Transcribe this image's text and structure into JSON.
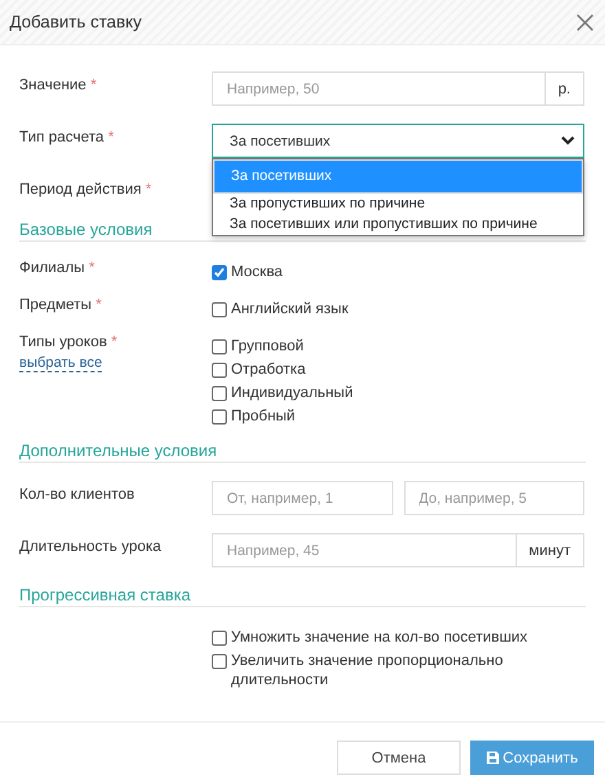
{
  "dialog": {
    "title": "Добавить ставку"
  },
  "fields": [
    {
      "kind": "input",
      "label": "Значение",
      "required_mark": "*",
      "placeholder": "Например, 50",
      "addon": "р."
    },
    {
      "kind": "select",
      "label": "Тип расчета",
      "required_mark": "*",
      "value": "За посетивших",
      "expanded": true,
      "options": [
        {
          "label": "За посетивших",
          "selected": true
        },
        {
          "label": "За пропустивших по причине",
          "selected": false
        },
        {
          "label": "За посетивших или пропустивших по причине",
          "selected": false
        }
      ]
    },
    {
      "kind": "covered",
      "label": "Период действия",
      "required_mark": "*"
    }
  ],
  "sections": [
    {
      "title": "Базовые условия",
      "rows": [
        {
          "kind": "checks",
          "label": "Филиалы",
          "required_mark": "*",
          "options": [
            {
              "label": "Москва",
              "checked": true
            }
          ]
        },
        {
          "kind": "checks",
          "label": "Предметы",
          "required_mark": "*",
          "options": [
            {
              "label": "Английский язык",
              "checked": false
            }
          ]
        },
        {
          "kind": "checks",
          "label": "Типы уроков",
          "required_mark": "*",
          "link": "выбрать все",
          "options": [
            {
              "label": "Групповой",
              "checked": false
            },
            {
              "label": "Отработка",
              "checked": false
            },
            {
              "label": "Индивидуальный",
              "checked": false
            },
            {
              "label": "Пробный",
              "checked": false
            }
          ]
        }
      ]
    },
    {
      "title": "Дополнительные условия",
      "rows": [
        {
          "kind": "range",
          "label": "Кол-во клиентов",
          "from_placeholder": "От, например, 1",
          "to_placeholder": "До, например, 5"
        },
        {
          "kind": "input",
          "label": "Длительность урока",
          "placeholder": "Например, 45",
          "addon": "минут"
        }
      ]
    },
    {
      "title": "Прогрессивная ставка",
      "rows": [
        {
          "kind": "checks",
          "options": [
            {
              "label": "Умножить значение на кол-во посетивших",
              "checked": false
            },
            {
              "label": "Увеличить значение пропорционально длительности",
              "checked": false
            }
          ]
        }
      ]
    }
  ],
  "buttons": [
    {
      "kind": "default",
      "label": "Отмена"
    },
    {
      "kind": "primary",
      "label": "Сохранить"
    }
  ]
}
